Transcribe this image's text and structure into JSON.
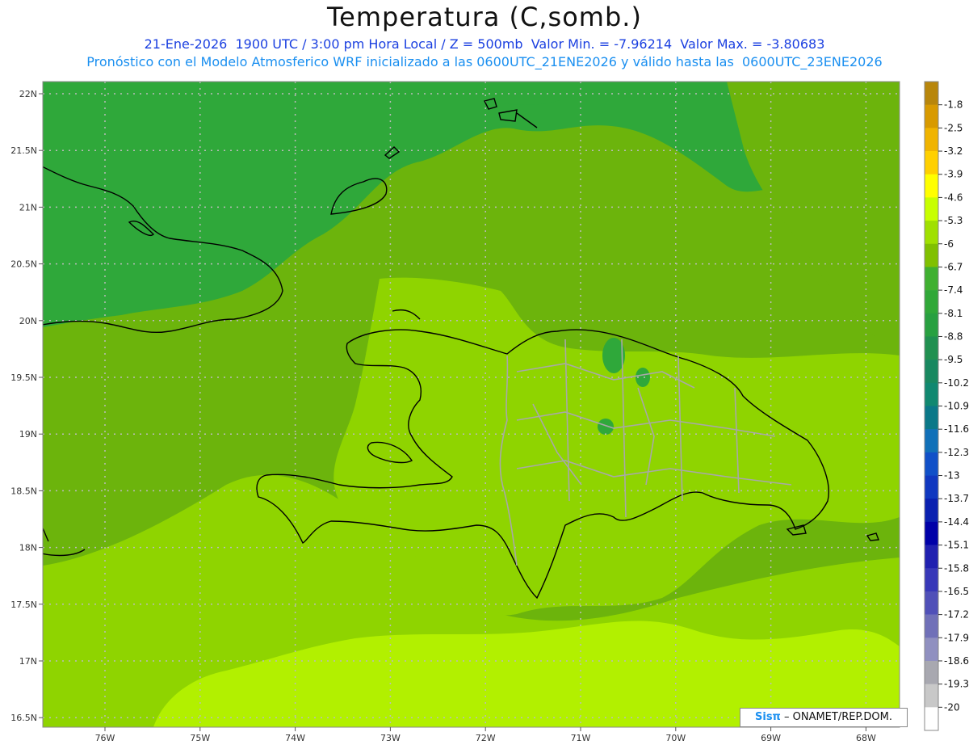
{
  "title": "Temperatura (C,somb.)",
  "subtitle_line1": "21-Ene-2026  1900 UTC / 3:00 pm Hora Local / Z = 500mb  Valor Min. = -7.96214  Valor Max. = -3.80683",
  "subtitle_line2": "Pronóstico con el Modelo Atmosferico WRF inicializado a las 0600UTC_21ENE2026 y válido hasta las  0600UTC_23ENE2026",
  "credit": {
    "brand": "Sisπ",
    "text": " – ONAMET/REP.DOM."
  },
  "map": {
    "lat_ticks": [
      "22N",
      "21.5N",
      "21N",
      "20.5N",
      "20N",
      "19.5N",
      "19N",
      "18.5N",
      "18N",
      "17.5N",
      "17N",
      "16.5N"
    ],
    "lon_ticks": [
      "76W",
      "75W",
      "74W",
      "73W",
      "72W",
      "71W",
      "70W",
      "69W",
      "68W"
    ]
  },
  "colorbar": {
    "labels": [
      "-1.8",
      "-2.5",
      "-3.2",
      "-3.9",
      "-4.6",
      "-5.3",
      "-6",
      "-6.7",
      "-7.4",
      "-8.1",
      "-8.8",
      "-9.5",
      "-10.2",
      "-10.9",
      "-11.6",
      "-12.3",
      "-13",
      "-13.7",
      "-14.4",
      "-15.1",
      "-15.8",
      "-16.5",
      "-17.2",
      "-17.9",
      "-18.6",
      "-19.3",
      "-20"
    ],
    "colors": [
      "#b8860b",
      "#d89a00",
      "#f0b400",
      "#ffd000",
      "#ffff00",
      "#c8ff00",
      "#a0e000",
      "#80c000",
      "#3fb030",
      "#30a838",
      "#28a040",
      "#209050",
      "#188860",
      "#108870",
      "#0a7888",
      "#1070b8",
      "#1050c8",
      "#1038c0",
      "#0a20b0",
      "#0000a8",
      "#2020b0",
      "#3838b8",
      "#5050b8",
      "#7070b8",
      "#9090c0",
      "#a8a8b0",
      "#c8c8c8",
      "#ffffff"
    ],
    "zone_colors": {
      "deep_green": "#2fa83a",
      "mid_green": "#6cb40c",
      "light_green": "#8fd400",
      "yellow_green": "#b2f000"
    }
  }
}
